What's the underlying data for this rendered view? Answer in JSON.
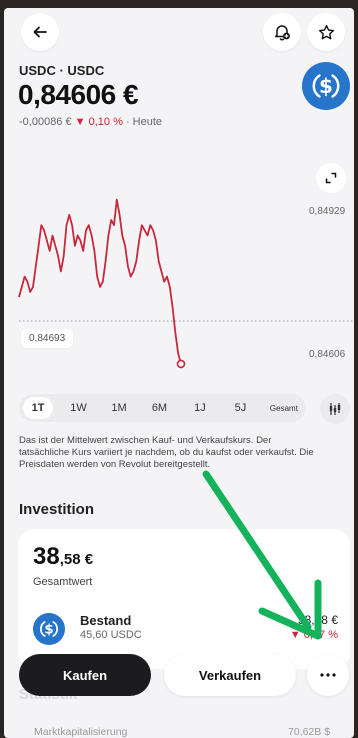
{
  "header": {
    "pair": "USDC · USDC",
    "price": "0,84606 €",
    "change_abs": "-0,00086 €",
    "change_arrow": "▼",
    "change_pct": "0,10 %",
    "change_period": "· Heute"
  },
  "chart": {
    "axis_high": "0,84929",
    "axis_low": "0,84606",
    "low_badge": "0,84693",
    "line_color": "#c8283c"
  },
  "chart_data": {
    "type": "line",
    "title": "",
    "xlabel": "",
    "ylabel": "",
    "ylim": [
      0.84606,
      0.84929
    ],
    "y_tick_labels": [
      "0,84929",
      "0,84606"
    ],
    "series": [
      {
        "values": [
          0.8474,
          0.8476,
          0.8478,
          0.8477,
          0.8475,
          0.8476,
          0.848,
          0.8484,
          0.8488,
          0.8487,
          0.8485,
          0.8483,
          0.8486,
          0.8484,
          0.8482,
          0.8479,
          0.8482,
          0.8488,
          0.849,
          0.8488,
          0.8484,
          0.8486,
          0.8485,
          0.8483,
          0.8487,
          0.8488,
          0.8486,
          0.8483,
          0.8478,
          0.8476,
          0.8477,
          0.8481,
          0.8486,
          0.8489,
          0.8488,
          0.8493,
          0.849,
          0.8486,
          0.8484,
          0.848,
          0.8478,
          0.8479,
          0.8481,
          0.8485,
          0.8488,
          0.8487,
          0.8486,
          0.8488,
          0.8487,
          0.8485,
          0.8481,
          0.8479,
          0.8477,
          0.8478,
          0.8476,
          0.8472,
          0.8467,
          0.8463,
          0.8461
        ]
      }
    ]
  },
  "ranges": [
    "1T",
    "1W",
    "1M",
    "6M",
    "1J",
    "5J",
    "Gesamt"
  ],
  "active_range": "1T",
  "disclaimer": "Das ist der Mittelwert zwischen Kauf- und Verkaufskurs. Der tatsächliche Kurs variiert je nachdem, ob du kaufst oder verkaufst. Die Preisdaten werden von Revolut bereitgestellt.",
  "investment": {
    "title": "Investition",
    "total_main": "38",
    "total_decimal": ",58 €",
    "total_label": "Gesamtwert",
    "holding_name": "Bestand",
    "holding_amount": "45,60 USDC",
    "holding_value": "38,58 €",
    "holding_change": "▼ 0,17 %"
  },
  "stats": {
    "title": "Statistik",
    "metric_label": "Marktkapitalisierung",
    "metric_value": "70,62B $"
  },
  "actions": {
    "buy": "Kaufen",
    "sell": "Verkaufen"
  },
  "colors": {
    "coin": "#2775ca",
    "accent_red": "#d0243a",
    "annotation_arrow": "#14b25a"
  },
  "icons": {
    "back": "arrow-left-icon",
    "alert": "bell-plus-icon",
    "watch": "star-icon",
    "expand": "expand-icon",
    "chart_type": "candlestick-icon",
    "more": "more-dots-icon",
    "coin": "usdc-coin-icon"
  }
}
